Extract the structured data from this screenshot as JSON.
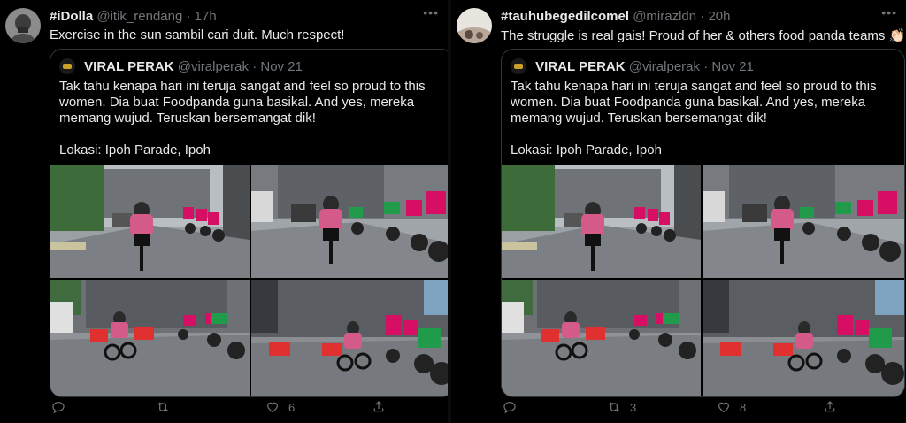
{
  "tweets": [
    {
      "display_name": "#iDolla",
      "handle": "@itik_rendang",
      "separator": "·",
      "time": "17h",
      "text": "Exercise in the sun sambil cari duit. Much respect!",
      "quote": {
        "display_name": "VIRAL PERAK",
        "handle": "@viralperak",
        "separator": "·",
        "time": "Nov 21",
        "body": "Tak tahu kenapa hari ini teruja sangat and feel so proud to this women. Dia buat Foodpanda guna basikal. And yes, mereka memang wujud. Teruskan bersemangat dik!",
        "location": "Lokasi: Ipoh Parade, Ipoh"
      },
      "actions": {
        "reply": "",
        "retweet": "",
        "like": "6",
        "share": ""
      }
    },
    {
      "display_name": "#tauhubegedilcomel",
      "handle": "@mirazldn",
      "separator": "·",
      "time": "20h",
      "text": "The struggle is real gais! Proud of her & others food panda teams 👏🏻",
      "quote": {
        "display_name": "VIRAL PERAK",
        "handle": "@viralperak",
        "separator": "·",
        "time": "Nov 21",
        "body": "Tak tahu kenapa hari ini teruja sangat and feel so proud to this women. Dia buat Foodpanda guna basikal. And yes, mereka memang wujud. Teruskan bersemangat dik!",
        "location": "Lokasi: Ipoh Parade, Ipoh"
      },
      "actions": {
        "reply": "",
        "retweet": "3",
        "like": "8",
        "share": ""
      }
    }
  ],
  "icons": {
    "more": "more-icon",
    "reply": "reply-icon",
    "retweet": "retweet-icon",
    "like": "like-icon",
    "share": "share-icon"
  },
  "colors": {
    "background": "#000000",
    "text": "#e7e9ea",
    "muted": "#71767b",
    "border": "#333639",
    "foodpanda_pink": "#d70f64",
    "grab_green": "#00b14f"
  }
}
